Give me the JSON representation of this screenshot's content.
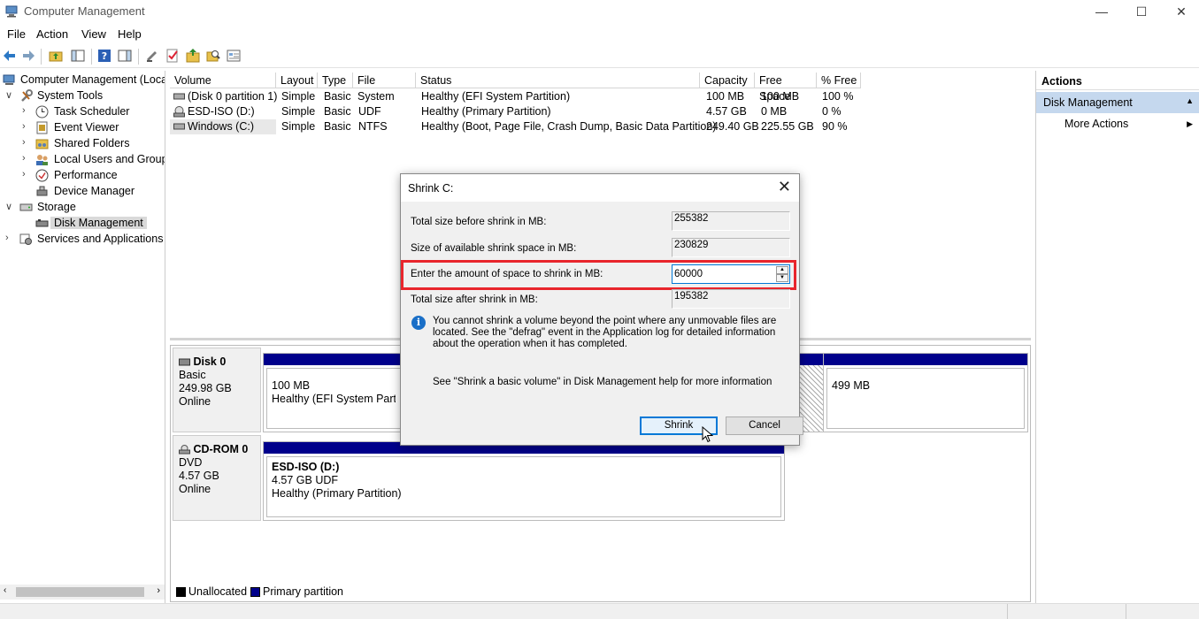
{
  "window": {
    "title": "Computer Management",
    "minimize": "—",
    "maximize": "☐",
    "close": "✕"
  },
  "menu": [
    "File",
    "Action",
    "View",
    "Help"
  ],
  "tree": {
    "root": "Computer Management (Local",
    "items": [
      {
        "label": "System Tools",
        "level": 1,
        "expanded": true
      },
      {
        "label": "Task Scheduler",
        "level": 2
      },
      {
        "label": "Event Viewer",
        "level": 2
      },
      {
        "label": "Shared Folders",
        "level": 2
      },
      {
        "label": "Local Users and Groups",
        "level": 2
      },
      {
        "label": "Performance",
        "level": 2
      },
      {
        "label": "Device Manager",
        "level": 2
      },
      {
        "label": "Storage",
        "level": 1,
        "expanded": true
      },
      {
        "label": "Disk Management",
        "level": 2,
        "selected": true
      },
      {
        "label": "Services and Applications",
        "level": 1
      }
    ]
  },
  "volumes": {
    "columns": [
      "Volume",
      "Layout",
      "Type",
      "File System",
      "Status",
      "Capacity",
      "Free Space",
      "% Free"
    ],
    "rows": [
      [
        "(Disk 0 partition 1)",
        "Simple",
        "Basic",
        "",
        "Healthy (EFI System Partition)",
        "100 MB",
        "100 MB",
        "100 %"
      ],
      [
        "ESD-ISO (D:)",
        "Simple",
        "Basic",
        "UDF",
        "Healthy (Primary Partition)",
        "4.57 GB",
        "0 MB",
        "0 %"
      ],
      [
        "Windows (C:)",
        "Simple",
        "Basic",
        "NTFS",
        "Healthy (Boot, Page File, Crash Dump, Basic Data Partition)",
        "249.40 GB",
        "225.55 GB",
        "90 %"
      ]
    ]
  },
  "disks": {
    "disk0": {
      "name": "Disk 0",
      "type": "Basic",
      "size": "249.98 GB",
      "state": "Online",
      "part1_size": "100 MB",
      "part1_status": "Healthy (EFI System Partition",
      "part3_size": "499 MB"
    },
    "cdrom0": {
      "name": "CD-ROM 0",
      "type": "DVD",
      "size": "4.57 GB",
      "state": "Online",
      "part_name": "ESD-ISO  (D:)",
      "part_size": "4.57 GB UDF",
      "part_status": "Healthy (Primary Partition)"
    }
  },
  "legend": {
    "unallocated": "Unallocated",
    "primary": "Primary partition",
    "unallocated_color": "#000000",
    "primary_color": "#00008b"
  },
  "actions": {
    "header": "Actions",
    "section": "Disk Management",
    "more": "More Actions"
  },
  "dialog": {
    "title": "Shrink C:",
    "total_before_label": "Total size before shrink in MB:",
    "total_before_value": "255382",
    "available_label": "Size of available shrink space in MB:",
    "available_value": "230829",
    "amount_label": "Enter the amount of space to shrink in MB:",
    "amount_value": "60000",
    "total_after_label": "Total size after shrink in MB:",
    "total_after_value": "195382",
    "info": "You cannot shrink a volume beyond the point where any unmovable files are located. See the \"defrag\" event in the Application log for detailed information about the operation when it has completed.",
    "help": "See \"Shrink a basic volume\" in Disk Management help for more information",
    "shrink_button": "Shrink",
    "cancel_button": "Cancel"
  }
}
